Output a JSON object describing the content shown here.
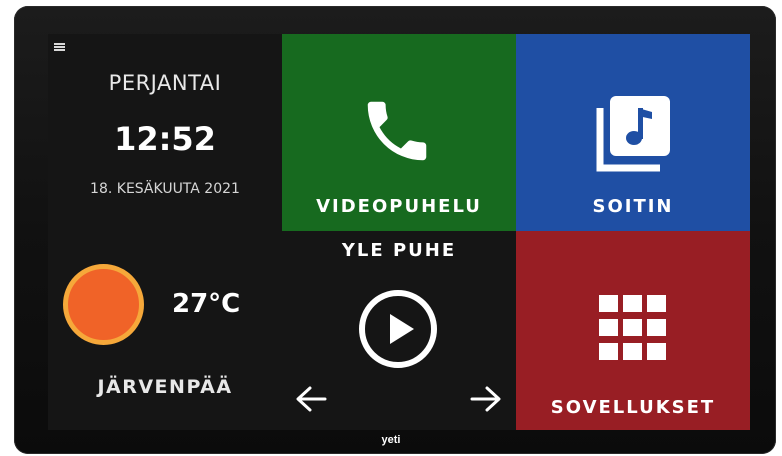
{
  "clock": {
    "day": "PERJANTAI",
    "time": "12:52",
    "date": "18. KESÄKUUTA 2021"
  },
  "weather": {
    "temperature": "27°C",
    "location": "JÄRVENPÄÄ",
    "icon": "sun-icon"
  },
  "tiles": {
    "videocall": {
      "label": "VIDEOPUHELU",
      "icon": "phone-icon",
      "color": "#176a1f"
    },
    "player": {
      "label": "SOITIN",
      "icon": "music-note-icon",
      "color": "#1f4fa4"
    },
    "apps": {
      "label": "SOVELLUKSET",
      "icon": "grid-icon",
      "color": "#981e24"
    }
  },
  "radio": {
    "station": "YLE PUHE"
  },
  "device": {
    "brand": "yeti"
  },
  "colors": {
    "screen_background": "#151515",
    "sun_fill": "#f06328",
    "sun_ring": "#f6a83a"
  }
}
